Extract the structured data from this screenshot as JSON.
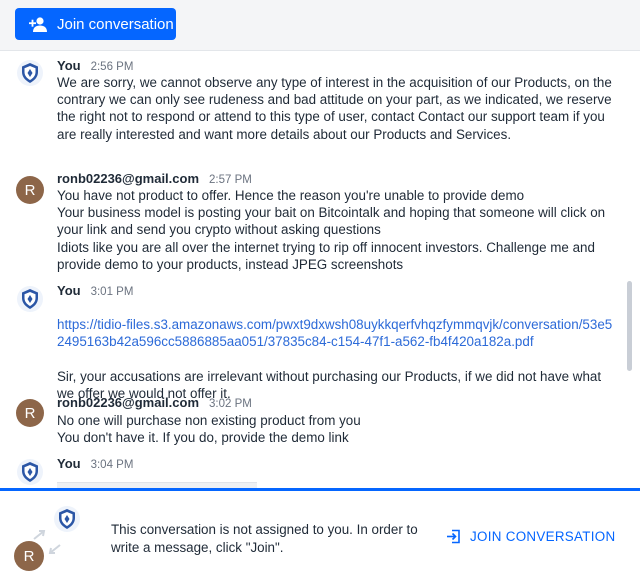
{
  "topbar": {
    "join_button_label": "Join conversation"
  },
  "messages": [
    {
      "author": "You",
      "time": "2:56 PM",
      "avatar": "shield-icon",
      "text": "We are sorry, we cannot observe any type of interest in the acquisition of our Products, on the contrary we can only see rudeness and bad attitude on your part, as we indicated, we reserve the right not to respond or attend to this type of user, contact Contact our support team if you are really interested and want more details about our Products and Services."
    },
    {
      "author": "ronb02236@gmail.com",
      "time": "2:57 PM",
      "avatar_letter": "R",
      "text": "You have not product to offer. Hence the reason you're unable to provide demo\nYour business model is posting your bait on Bitcointalk and hoping that someone will click on your link and send you crypto without asking questions\nIdiots like you are all over the internet trying to rip off innocent investors. Challenge me and provide demo to your products, instead JPEG screenshots"
    },
    {
      "author": "You",
      "time": "3:01 PM",
      "avatar": "shield-icon",
      "link": "https://tidio-files.s3.amazonaws.com/pwxt9dxwsh08uykkqerfvhqzfymmqvjk/conversation/53e52495163b42a596cc5886885aa051/37835c84-c154-47f1-a562-fb4f420a182a.pdf",
      "text": "Sir, your accusations are irrelevant without purchasing our Products, if we did not have what we offer we would not offer it."
    },
    {
      "author": "ronb02236@gmail.com",
      "time": "3:02 PM",
      "avatar_letter": "R",
      "text": "No one will purchase non existing product from you\nYou don't have it. If you do, provide the demo link"
    },
    {
      "author": "You",
      "time": "3:04 PM",
      "avatar": "shield-icon",
      "text": ""
    }
  ],
  "footer": {
    "avatar_letter": "R",
    "notice": "This conversation is not assigned to you. In order to write a message, click \"Join\".",
    "join_link_label": "JOIN CONVERSATION"
  },
  "colors": {
    "accent": "#0566ff",
    "avatar_brown": "#8d6649",
    "link": "#2c6ad8"
  }
}
